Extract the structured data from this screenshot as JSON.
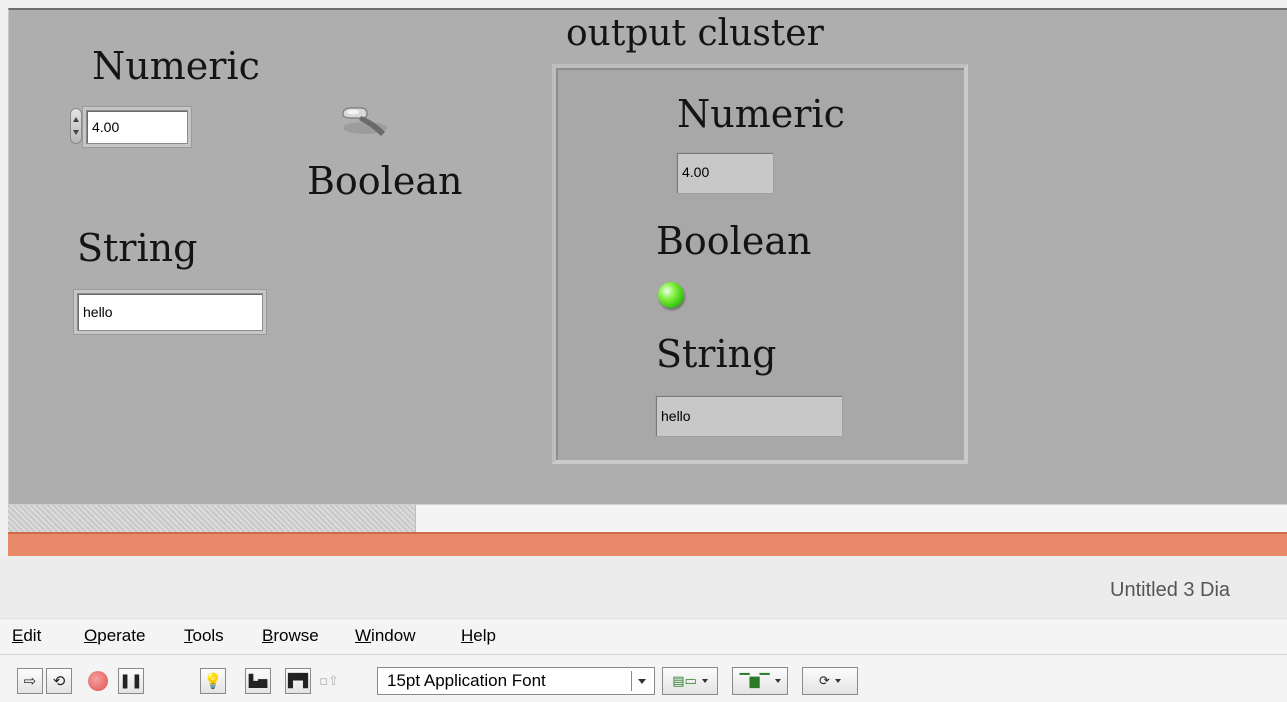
{
  "front_panel": {
    "numeric_control": {
      "label": "Numeric",
      "value": "4.00"
    },
    "boolean_control": {
      "label": "Boolean",
      "state": "off"
    },
    "string_control": {
      "label": "String",
      "value": "hello"
    },
    "output_cluster": {
      "label": "output cluster",
      "numeric": {
        "label": "Numeric",
        "value": "4.00"
      },
      "boolean": {
        "label": "Boolean",
        "state": "on",
        "led_color": "#4fdc20"
      },
      "string": {
        "label": "String",
        "value": "hello"
      }
    }
  },
  "window": {
    "title": "Untitled 3 Dia"
  },
  "menu": {
    "edit": {
      "accel": "E",
      "rest": "dit"
    },
    "operate": {
      "accel": "O",
      "rest": "perate"
    },
    "tools": {
      "accel": "T",
      "rest": "ools"
    },
    "browse": {
      "accel": "B",
      "rest": "rowse"
    },
    "window": {
      "accel": "W",
      "rest": "indow"
    },
    "help": {
      "accel": "H",
      "rest": "elp"
    }
  },
  "toolbar": {
    "font": "15pt Application Font",
    "icons": [
      "run-arrow-icon",
      "run-continuously-icon",
      "abort-icon",
      "pause-icon",
      "highlight-execution-icon",
      "retain-wire-values-icon",
      "step-into-icon",
      "step-out-icon",
      "align-objects-icon",
      "distribute-objects-icon",
      "reorder-icon"
    ]
  },
  "colors": {
    "panel_bg": "#aeaeae",
    "cluster_bg": "#a8a8a8",
    "accent_bar": "#e8896a"
  }
}
